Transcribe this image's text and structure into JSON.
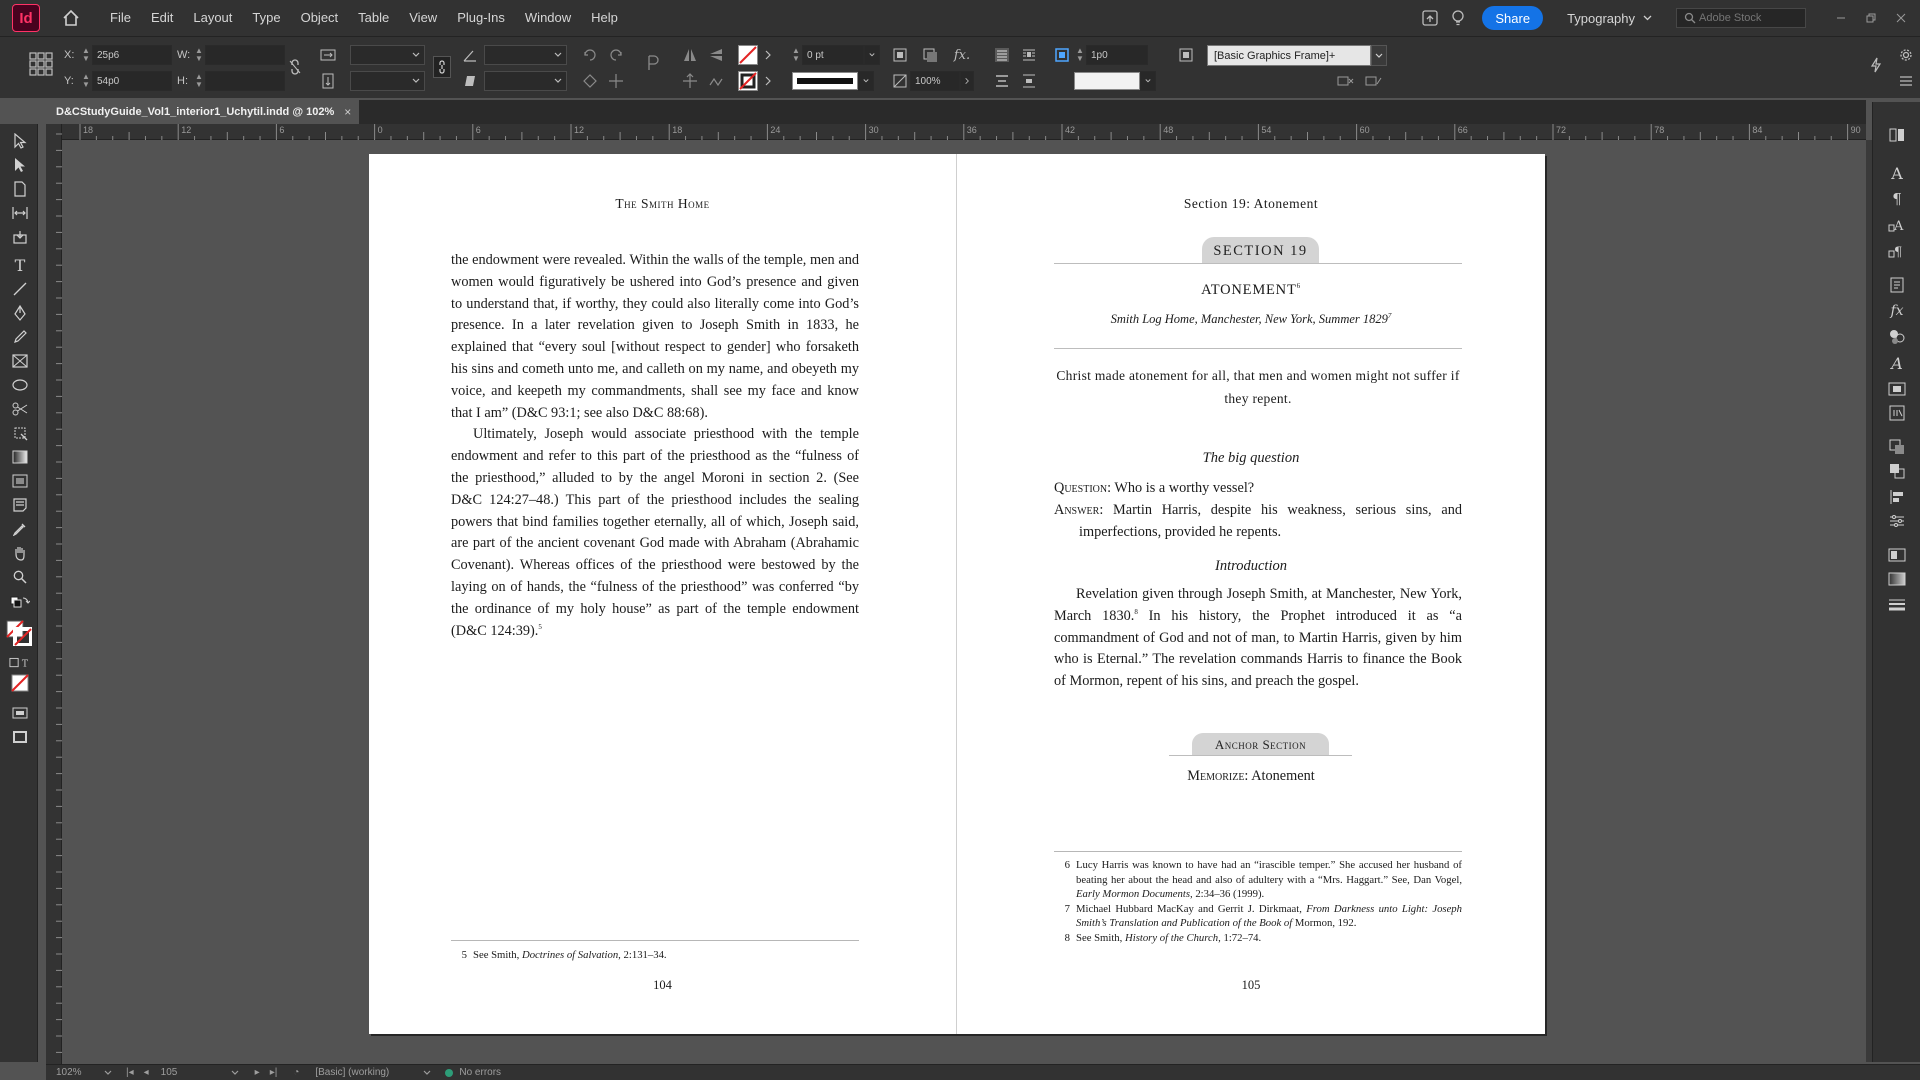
{
  "app": {
    "name": "Adobe InDesign",
    "logo_text": "Id",
    "menu": [
      "File",
      "Edit",
      "Layout",
      "Type",
      "Object",
      "Table",
      "View",
      "Plug-Ins",
      "Window",
      "Help"
    ],
    "share_label": "Share",
    "workspace": "Typography",
    "stock_placeholder": "Adobe Stock",
    "colors": {
      "accent": "#1473e6",
      "brand": "#ff3366",
      "brand_bg": "#49021f",
      "ui_bg": "#323232",
      "pasteboard": "#535353",
      "status_ok": "#2d9d78"
    }
  },
  "control": {
    "x_label": "X:",
    "x_value": "25p6",
    "y_label": "Y:",
    "y_value": "54p0",
    "w_label": "W:",
    "w_value": "",
    "h_label": "H:",
    "h_value": "",
    "stroke_weight": "0 pt",
    "opacity": "100%",
    "frame_inset": "1p0",
    "object_style": "[Basic Graphics Frame]+"
  },
  "document": {
    "tab_title": "D&CStudyGuide_Vol1_interior1_Uchytil.indd @ 102%",
    "close_glyph": "×"
  },
  "ruler": {
    "labels": [
      "18",
      "12",
      "6",
      "0",
      "6",
      "12",
      "18",
      "24",
      "30",
      "36",
      "42",
      "48",
      "54",
      "60",
      "66",
      "72",
      "78",
      "84",
      "90"
    ]
  },
  "left_page": {
    "running_head": "The Smith Home",
    "paragraph_1": "the endowment were revealed. Within the walls of the temple, men and women would figuratively be ushered into God’s presence and given to understand that, if worthy, they could also literally come into God’s presence. In a later revelation given to Joseph Smith in 1833, he explained that “every soul [without respect to gender] who forsaketh his sins and cometh unto me, and calleth on my name, and obeyeth my voice, and keepeth my commandments, shall see my face and know that I am” (D&C 93:1; see also D&C 88:68).",
    "paragraph_2": "Ultimately, Joseph would associate priesthood with the temple endowment and refer to this part of the priesthood as the “fulness of the priesthood,” alluded to by the angel Moroni in section 2. (See D&C 124:27–48.) This part of the priesthood includes the sealing powers that bind families together eternally, all of which, Joseph said, are part of the ancient covenant God made with Abraham (Abrahamic Covenant). Whereas offices of the priesthood were bestowed by the laying on of hands, the “fulness of the priesthood” was conferred “by the ordinance of my holy house” as part of the temple endowment (D&C 124:39).",
    "paragraph_2_note": "5",
    "footnote_num": "5",
    "footnote_text": "See Smith, ",
    "footnote_title": "Doctrines of Salvation,",
    "footnote_tail": " 2:131–34.",
    "folio": "104"
  },
  "right_page": {
    "running_head": "Section 19: Atonement",
    "section_badge": "SECTION 19",
    "title": "ATONEMENT",
    "title_note": "6",
    "subtitle": "Smith Log Home, Manchester, New York, Summer 1829",
    "subtitle_note": "7",
    "summary": "Christ made atonement for all, that men and women might not suffer if they repent.",
    "big_question_heading": "The big question",
    "question_label": "Question:",
    "question_text": " Who is a worthy vessel?",
    "answer_label": "Answer:",
    "answer_text": " Martin Harris, despite his weakness, serious sins, and imperfections, provided he repents.",
    "intro_heading": "Introduction",
    "intro_a": "Revelation given through Joseph Smith, at Manchester, New York, March 1830.",
    "intro_note": "8",
    "intro_b": " In his history, the Prophet introduced it as “a commandment of God and not of man, to Martin Harris, given by him who is Eternal.” The revelation commands Harris to finance the Book of Mormon, repent of his sins, and preach the gospel.",
    "anchor_badge": "Anchor Section",
    "memorize_label": "Memorize:",
    "memorize_text": " Atonement",
    "fn6_num": "6",
    "fn6_a": "Lucy Harris was known to have had an “irascible temper.” She accused her husband of beating her about the head and also of adultery with a “Mrs. Haggart.” See, Dan Vogel, ",
    "fn6_title": "Early Mormon Documents,",
    "fn6_b": " 2:34–36 (1999).",
    "fn7_num": "7",
    "fn7_a": "Michael Hubbard MacKay and Gerrit J. Dirkmaat, ",
    "fn7_title": "From Darkness unto Light: Joseph Smith’s Translation and Publication of the Book of",
    "fn7_b": " Mormon, 192.",
    "fn8_num": "8",
    "fn8_a": "See Smith, ",
    "fn8_title": "History of the Church,",
    "fn8_b": " 1:72–74.",
    "folio": "105"
  },
  "status": {
    "zoom": "102%",
    "page": "105",
    "preflight_profile": "[Basic] (working)",
    "errors": "No errors"
  }
}
